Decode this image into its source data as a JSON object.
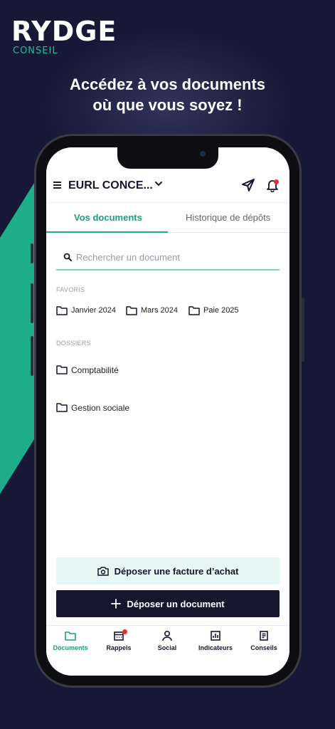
{
  "brand": {
    "name": "RYDGE",
    "sub": "CONSEIL",
    "accent": "#1fae8c",
    "background": "#171836"
  },
  "headline": {
    "line1": "Accédez à vos documents",
    "line2": "où que vous soyez !"
  },
  "app": {
    "company": "EURL CONCE...",
    "company_chevron": "chevron-down-icon",
    "tabs": [
      {
        "label": "Vos documents",
        "active": true
      },
      {
        "label": "Historique de dépôts",
        "active": false
      }
    ],
    "search": {
      "placeholder": "Rechercher un document",
      "value": ""
    },
    "favoris": {
      "label": "FAVORIS",
      "items": [
        {
          "label": "Janvier 2024"
        },
        {
          "label": "Mars 2024"
        },
        {
          "label": "Paie 2025"
        }
      ]
    },
    "dossiers": {
      "label": "DOSSIERS",
      "items": [
        {
          "label": "Comptabilité"
        },
        {
          "label": "Gestion sociale"
        }
      ]
    },
    "actions": {
      "facture": "Déposer une facture d’achat",
      "document": "Déposer un document"
    },
    "nav": [
      {
        "label": "Documents",
        "icon": "folder-icon",
        "active": true
      },
      {
        "label": "Rappels",
        "icon": "calendar-icon",
        "active": false
      },
      {
        "label": "Social",
        "icon": "person-icon",
        "active": false
      },
      {
        "label": "Indicateurs",
        "icon": "chart-icon",
        "active": false
      },
      {
        "label": "Conseils",
        "icon": "notes-icon",
        "active": false
      }
    ]
  }
}
